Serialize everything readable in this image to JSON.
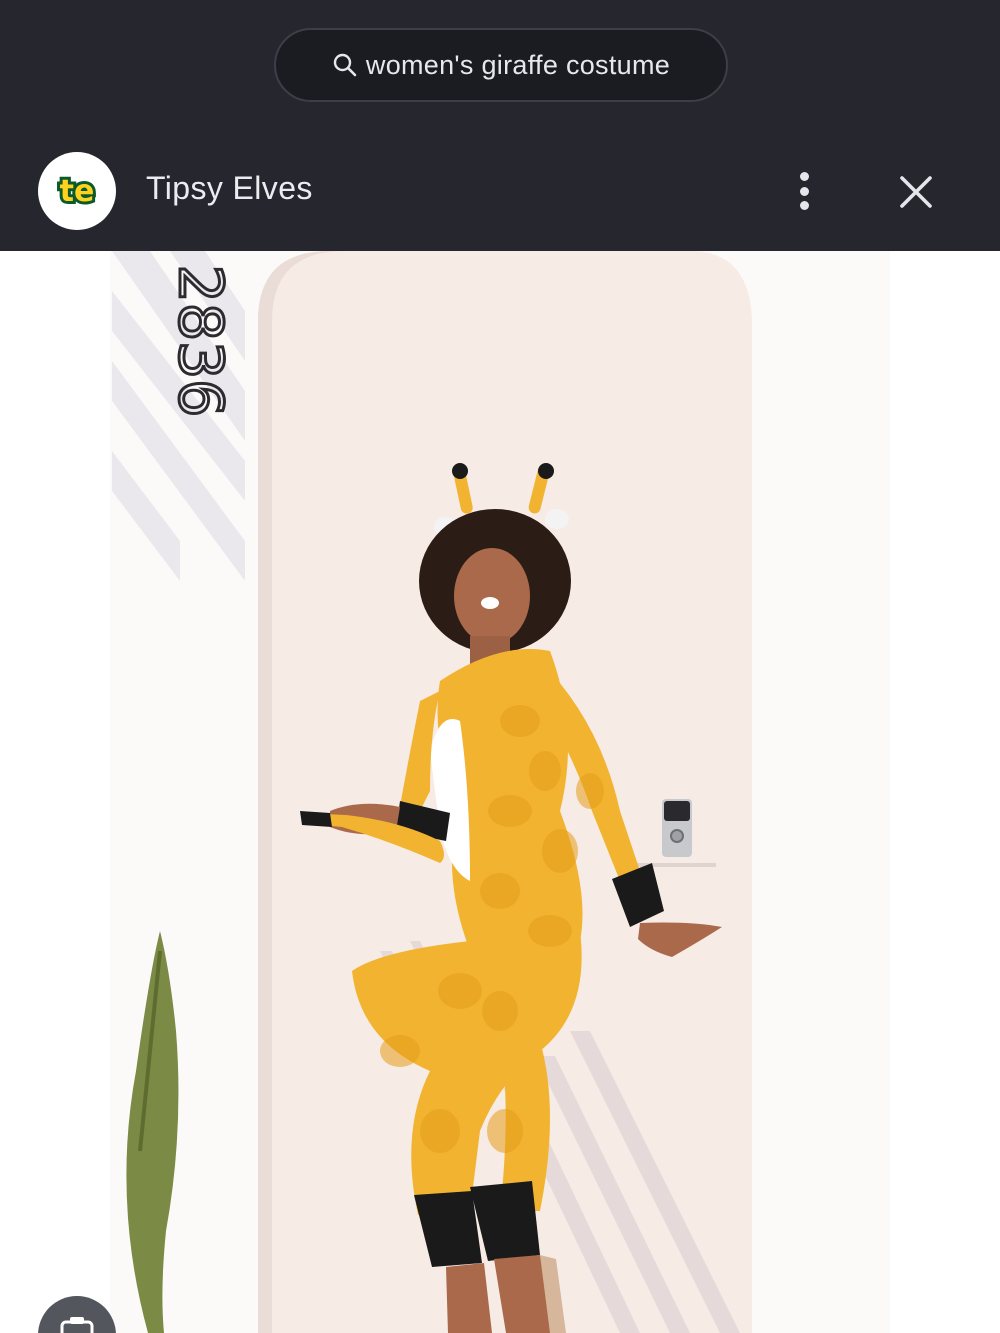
{
  "search": {
    "query": "women's giraffe costume",
    "icon": "search-icon"
  },
  "source": {
    "logo_text": "te",
    "name": "Tipsy Elves",
    "more_icon": "more-vert-icon",
    "close_icon": "close-icon"
  },
  "photo": {
    "house_number": "2836"
  },
  "overlay": {
    "lens_icon": "lens-icon"
  },
  "colors": {
    "topbar": "#25262e",
    "costume_yellow": "#f2b430",
    "costume_cream": "#fbead2",
    "cuff_black": "#1a1a1a"
  }
}
